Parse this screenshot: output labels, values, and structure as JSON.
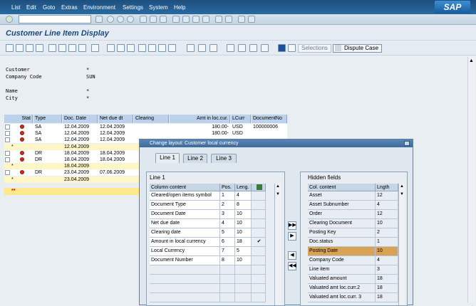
{
  "menu": {
    "items": [
      "List",
      "Edit",
      "Goto",
      "Extras",
      "Environment",
      "Settings",
      "System",
      "Help"
    ]
  },
  "logo": "SAP",
  "page": {
    "title": "Customer Line Item Display"
  },
  "toolbar": {
    "selections_label": "Selections",
    "dispute_label": "Dispute Case"
  },
  "header": {
    "rows": [
      {
        "label": "Customer",
        "value": "*"
      },
      {
        "label": "Company Code",
        "value": "SUN"
      },
      {
        "label": "Name",
        "value": "*"
      },
      {
        "label": "City",
        "value": "*"
      }
    ]
  },
  "grid": {
    "columns": [
      "Stat",
      "Type",
      "Doc. Date",
      "Net due dt",
      "Clearing",
      "Amt in loc.cur.",
      "LCurr",
      "DocumentNo"
    ],
    "rows": [
      {
        "stat": true,
        "type": "SA",
        "doc_date": "12.04.2009",
        "net_due": "12.04.2009",
        "amount": "180.00-",
        "curr": "USD",
        "docno": "100000006"
      },
      {
        "stat": true,
        "type": "SA",
        "doc_date": "12.04.2009",
        "net_due": "12.04.2009",
        "amount": "180.00-",
        "curr": "USD",
        "docno": ""
      },
      {
        "stat": true,
        "type": "SA",
        "doc_date": "12.04.2009",
        "net_due": "12.04.2009",
        "amount": "",
        "curr": "",
        "docno": ""
      },
      {
        "sub": true,
        "mark": "*",
        "doc_date": "12.04.2009"
      },
      {
        "stat": true,
        "type": "DR",
        "doc_date": "18.04.2009",
        "net_due": "18.04.2009"
      },
      {
        "stat": true,
        "type": "DR",
        "doc_date": "18.04.2009",
        "net_due": "18.04.2009"
      },
      {
        "sub": true,
        "mark": "*",
        "doc_date": "18.04.2009"
      },
      {
        "stat": true,
        "type": "DR",
        "doc_date": "23.04.2009",
        "net_due": "07.06.2009"
      },
      {
        "sub": true,
        "mark": "*",
        "doc_date": "23.04.2009"
      }
    ],
    "total_mark": "**"
  },
  "dialog": {
    "title": "Change layout: Customer local currency",
    "tabs": [
      "Line 1",
      "Line 2",
      "Line 3"
    ],
    "left": {
      "title": "Line 1",
      "headers": [
        "Column content",
        "Pos.",
        "Leng."
      ],
      "rows": [
        {
          "content": "Cleared/open items symbol",
          "pos": "1",
          "len": "4",
          "check": false
        },
        {
          "content": "Document Type",
          "pos": "2",
          "len": "8",
          "check": false
        },
        {
          "content": "Document Date",
          "pos": "3",
          "len": "10",
          "check": false
        },
        {
          "content": "Net due date",
          "pos": "4",
          "len": "10",
          "check": false
        },
        {
          "content": "Clearing date",
          "pos": "5",
          "len": "10",
          "check": false
        },
        {
          "content": "Amount in local currency",
          "pos": "6",
          "len": "18",
          "check": true
        },
        {
          "content": "Local Currency",
          "pos": "7",
          "len": "5",
          "check": false
        },
        {
          "content": "Document Number",
          "pos": "8",
          "len": "10",
          "check": false
        }
      ]
    },
    "right": {
      "title": "Hidden fields",
      "headers": [
        "Col. content",
        "Lngth"
      ],
      "rows": [
        {
          "content": "Asset",
          "len": "12"
        },
        {
          "content": "Asset Subnumber",
          "len": "4"
        },
        {
          "content": "Order",
          "len": "12"
        },
        {
          "content": "Clearing Document",
          "len": "10"
        },
        {
          "content": "Posting Key",
          "len": "2"
        },
        {
          "content": "Doc.status",
          "len": "1"
        },
        {
          "content": "Posting Date",
          "len": "10",
          "selected": true
        },
        {
          "content": "Company Code",
          "len": "4"
        },
        {
          "content": "Line item",
          "len": "3"
        },
        {
          "content": "Valuated amount",
          "len": "18"
        },
        {
          "content": "Valuated amt loc.curr.2",
          "len": "18"
        },
        {
          "content": "Valuated amt loc.curr. 3",
          "len": "18"
        }
      ]
    }
  }
}
